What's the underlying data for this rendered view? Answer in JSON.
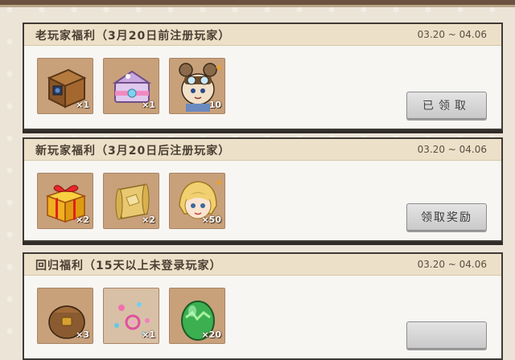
{
  "panels": [
    {
      "title": "老玩家福利（3月20日前注册玩家）",
      "date": "03.20 ~ 04.06",
      "button": "已领取",
      "items": [
        {
          "icon": "wooden-chest-icon",
          "count": "×1"
        },
        {
          "icon": "envelope-icon",
          "count": "×1"
        },
        {
          "icon": "pilot-mouse-character-icon",
          "count": "10"
        }
      ]
    },
    {
      "title": "新玩家福利（3月20日后注册玩家）",
      "date": "03.20 ~ 04.06",
      "button": "领取奖励",
      "items": [
        {
          "icon": "gift-box-icon",
          "count": "×2"
        },
        {
          "icon": "scroll-icon",
          "count": "×2"
        },
        {
          "icon": "blonde-character-icon",
          "count": "×50"
        }
      ]
    },
    {
      "title": "回归福利（15天以上未登录玩家）",
      "date": "03.20 ~ 04.06",
      "button": "",
      "items": [
        {
          "icon": "leather-bag-icon",
          "count": "×3"
        },
        {
          "icon": "magic-sparkle-icon",
          "count": "×1"
        },
        {
          "icon": "green-egg-icon",
          "count": "×20"
        }
      ]
    }
  ],
  "colors": {
    "page_bg": "#ece4d7",
    "panel_bg": "#f7f6f3",
    "header_bg": "#ede0c8",
    "item_bg": "#c8a17b",
    "button_bg": "#d6d6d6"
  }
}
